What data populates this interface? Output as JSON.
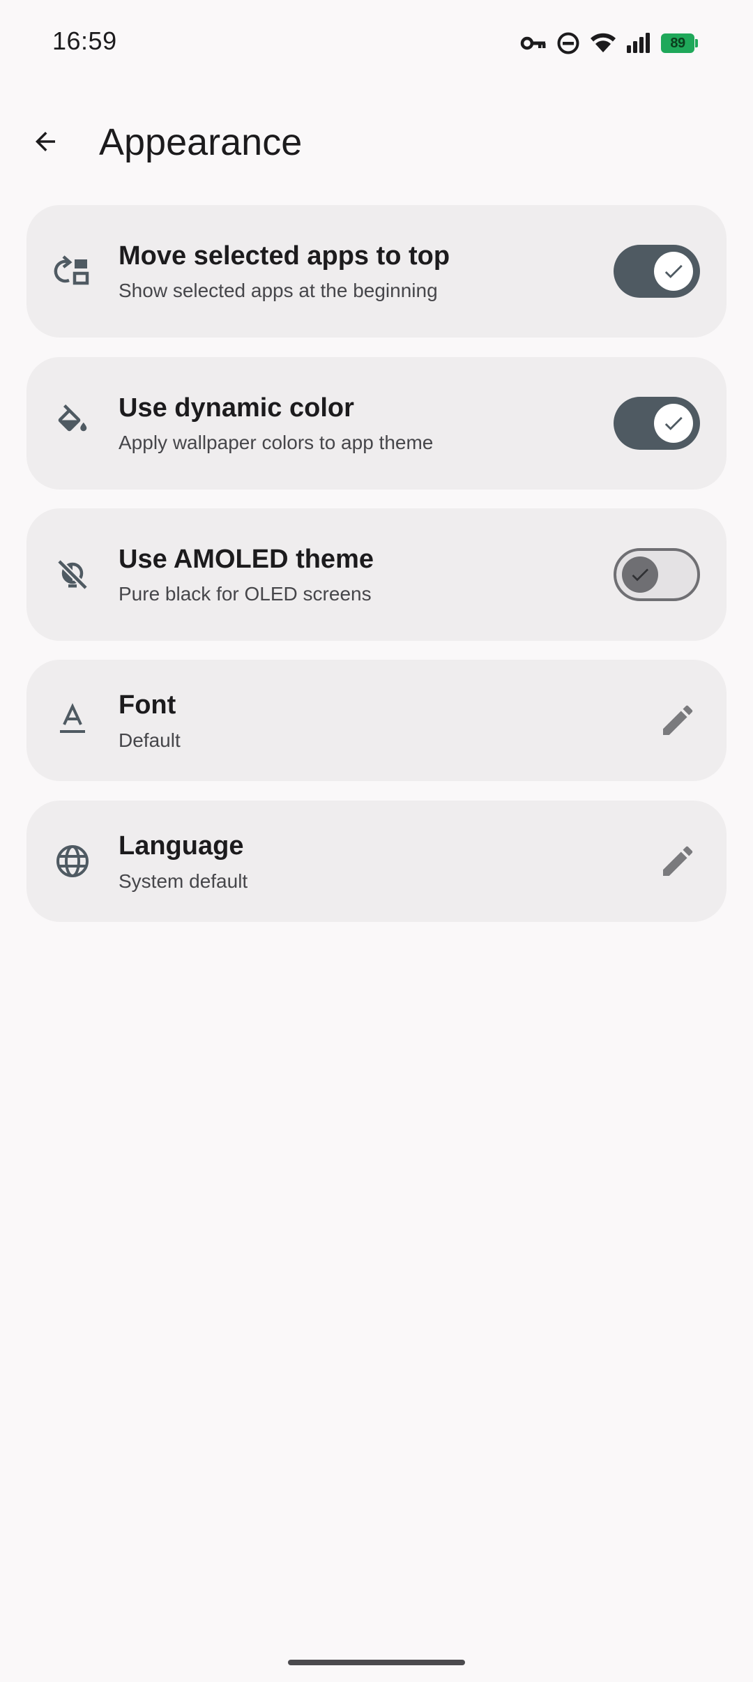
{
  "status_bar": {
    "time": "16:59",
    "icons": [
      "vpn-key-icon",
      "dnd-icon",
      "wifi-icon",
      "signal-icon"
    ],
    "battery_level": "89",
    "battery_color": "#1fa85a"
  },
  "app_bar": {
    "back_icon": "arrow-back-icon",
    "title": "Appearance"
  },
  "settings": {
    "move_selected": {
      "icon": "move-to-top-icon",
      "title": "Move selected apps to top",
      "subtitle": "Show selected apps at the beginning",
      "enabled": true
    },
    "dynamic_color": {
      "icon": "paint-bucket-icon",
      "title": "Use dynamic color",
      "subtitle": "Apply wallpaper colors to app theme",
      "enabled": true
    },
    "amoled": {
      "icon": "contrast-off-icon",
      "title": "Use AMOLED theme",
      "subtitle": "Pure black for OLED screens",
      "enabled": false
    },
    "font": {
      "icon": "font-icon",
      "title": "Font",
      "value": "Default",
      "action_icon": "edit-pencil-icon"
    },
    "language": {
      "icon": "globe-icon",
      "title": "Language",
      "value": "System default",
      "action_icon": "edit-pencil-icon"
    }
  },
  "colors": {
    "background": "#faf8f9",
    "card": "#efedee",
    "switch_on_track": "#4f5a62",
    "switch_off_track": "#e4e2e4",
    "icon": "#4f5a62"
  }
}
